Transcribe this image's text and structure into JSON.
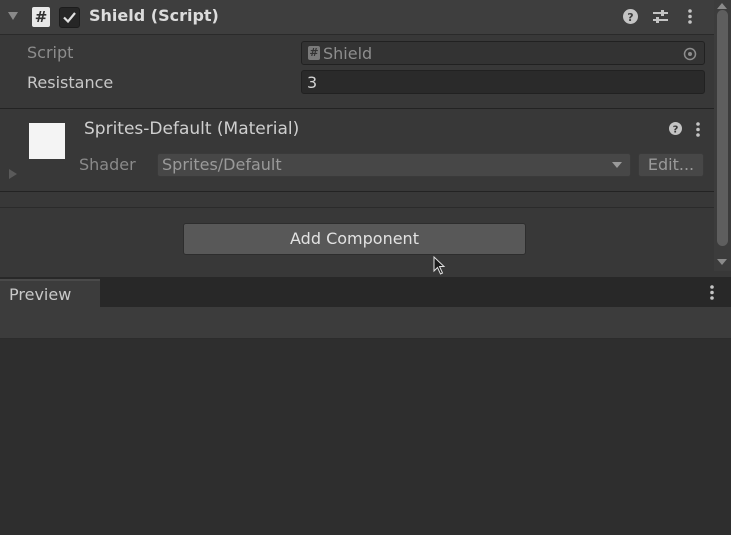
{
  "component": {
    "title": "Shield (Script)",
    "enabled": true,
    "icons": [
      "help-icon",
      "presets-icon",
      "kebab-menu-icon"
    ]
  },
  "properties": {
    "script_label": "Script",
    "script_value": "Shield",
    "resistance_label": "Resistance",
    "resistance_value": "3"
  },
  "material": {
    "title": "Sprites-Default (Material)",
    "shader_label": "Shader",
    "shader_value": "Sprites/Default",
    "edit_label": "Edit..."
  },
  "add_component_label": "Add Component",
  "preview": {
    "tab_label": "Preview"
  }
}
